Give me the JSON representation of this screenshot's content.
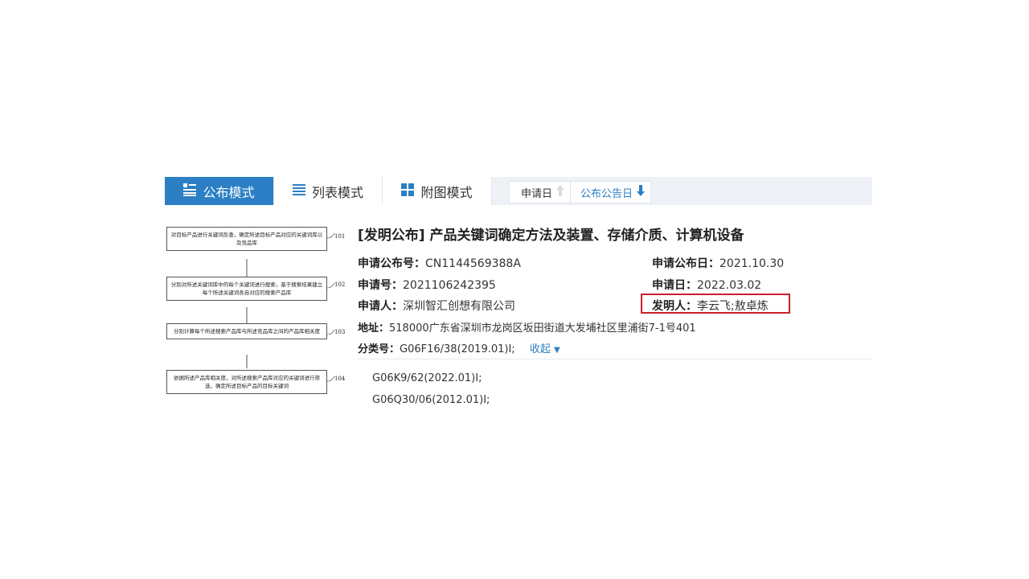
{
  "toolbar": {
    "tabs": [
      {
        "label": "公布模式",
        "icon": "publication-icon",
        "active": true
      },
      {
        "label": "列表模式",
        "icon": "list-icon",
        "active": false
      },
      {
        "label": "附图模式",
        "icon": "grid-icon",
        "active": false
      }
    ],
    "sort": [
      {
        "label": "申请日",
        "icon": "arrow-up-icon"
      },
      {
        "label": "公布公告日",
        "icon": "arrow-down-icon"
      }
    ]
  },
  "flowchart": {
    "steps": [
      {
        "text": "对目标产品进行关键词反查，确定所述目标产品对应的关键词库以及竞品库",
        "num": "101"
      },
      {
        "text": "分别对所述关键词库中的每个关键词进行搜索，基于搜索结果建立每个所述关键词各自对应的搜索产品库",
        "num": "102"
      },
      {
        "text": "分别计算每个所述搜索产品库与所述竞品库之间的产品库相关度",
        "num": "103"
      },
      {
        "text": "依据所述产品库相关度，对所述搜索产品库对应的关键词进行筛选，确定所述目标产品的目标关键词",
        "num": "104"
      }
    ]
  },
  "detail": {
    "title": "[发明公布] 产品关键词确定方法及装置、存储介质、计算机设备",
    "pub_no_label": "申请公布号：",
    "pub_no": "CN1144569388A",
    "pub_date_label": "申请公布日：",
    "pub_date": "2021.10.30",
    "app_no_label": "申请号：",
    "app_no": "2021106242395",
    "app_date_label": "申请日：",
    "app_date": "2022.03.02",
    "applicant_label": "申请人：",
    "applicant": "深圳智汇创想有限公司",
    "inventor_label": "发明人：",
    "inventor": "李云飞;敖卓炼",
    "address_label": "地址：",
    "address": "518000广东省深圳市龙岗区坂田街道大发埔社区里浦街7-1号401",
    "class_label": "分类号：",
    "class_value": "G06F16/38(2019.01)I;",
    "collapse": "收起",
    "class_more": [
      "G06K9/62(2022.01)I;",
      "G06Q30/06(2012.01)I;"
    ]
  },
  "colors": {
    "accent": "#2c7fc4",
    "highlight": "#c8202a",
    "toolbar_bg": "#eef2f7"
  }
}
